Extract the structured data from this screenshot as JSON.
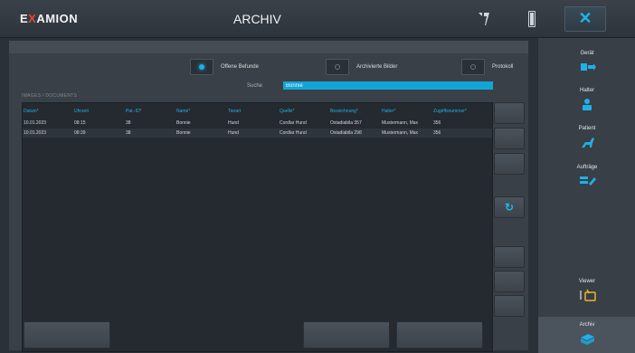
{
  "header": {
    "logo_pre": "E",
    "logo_x": "X",
    "logo_post": "AMION",
    "title": "ARCHIV",
    "close_label": "✕"
  },
  "filters": {
    "offene_befunde": "Offene Befunde",
    "archivierte_bilder": "Archivierte Bilder",
    "protokoll": "Protokoll",
    "search_label": "Suche",
    "search_value": "Bonnie"
  },
  "table": {
    "caption": "IMAGES / DOCUMENTS",
    "headers": [
      "Datum*",
      "Uhrzeit",
      "Pat.-ID*",
      "Name*",
      "Tierart",
      "Quelle*",
      "Bezeichnung*",
      "Halter*",
      "Zugriffsnummer*"
    ],
    "rows": [
      [
        "10.01.2023",
        "08:15",
        "38",
        "Bonnie",
        "Hund",
        "Cordlar Hund",
        "Oxtadiabila 357",
        "Mustermann, Max",
        "356"
      ],
      [
        "10.01.2023",
        "08:39",
        "38",
        "Bonnie",
        "Hund",
        "Cordlar Hund",
        "Oxtadiabila 298",
        "Mustermann, Max",
        "356"
      ]
    ]
  },
  "sidebar": {
    "items": [
      {
        "label": "Gerät"
      },
      {
        "label": "Halter"
      },
      {
        "label": "Patient"
      },
      {
        "label": "Aufträge"
      },
      {
        "label": "Viewer"
      },
      {
        "label": "Archiv"
      }
    ]
  },
  "colors": {
    "accent": "#1ab0e8",
    "background": "#2b3138",
    "panel": "#3a4047"
  }
}
